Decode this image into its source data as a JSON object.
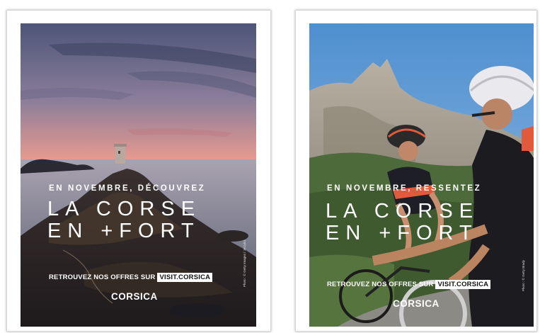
{
  "posters": [
    {
      "kicker": "EN NOVEMBRE, DÉCOUVREZ",
      "headline_line1": "LA CORSE",
      "headline_line2": "EN +FORT",
      "offers_text": "RETROUVEZ NOS OFFRES SUR",
      "offers_site": "VISIT.CORSICA",
      "logo": "CORSICA",
      "credit": "Photo : © Getty Images / Jerzyk4"
    },
    {
      "kicker": "EN NOVEMBRE, RESSENTEZ",
      "headline_line1": "LA CORSE",
      "headline_line2": "EN +FORT",
      "offers_text": "RETROUVEZ NOS OFFRES SUR",
      "offers_site": "VISIT.CORSICA",
      "logo": "CORSICA",
      "credit": "Photo : © Getty Brady"
    }
  ],
  "colors": {
    "sky_sunset_top": "#5a5a7a",
    "sky_sunset_bottom": "#f08468",
    "sky_blue": "#6a9ed3",
    "jersey_red": "#e25a3c"
  }
}
